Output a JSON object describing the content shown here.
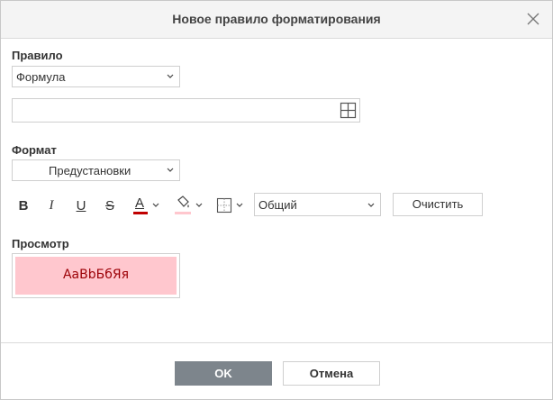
{
  "dialog": {
    "title": "Новое правило форматирования",
    "close_icon": "close-icon"
  },
  "rule": {
    "label": "Правило",
    "selected": "Формула",
    "formula_value": "",
    "range_icon": "select-range-icon"
  },
  "format": {
    "label": "Формат",
    "preset_selected": "Предустановки",
    "toolbar": {
      "bold": "B",
      "italic": "I",
      "underline": "U",
      "strike": "S",
      "font_color": "A",
      "font_color_bar": "#c00000",
      "fill_color_bar": "#ffc7ce",
      "number_format_selected": "Общий",
      "clear_label": "Очистить"
    }
  },
  "preview": {
    "label": "Просмотр",
    "sample": "АаВbБбЯя",
    "fill": "#ffc7ce",
    "text_color": "#9c0006"
  },
  "footer": {
    "ok_label": "OK",
    "cancel_label": "Отмена",
    "ok_color": "#7d858c"
  }
}
